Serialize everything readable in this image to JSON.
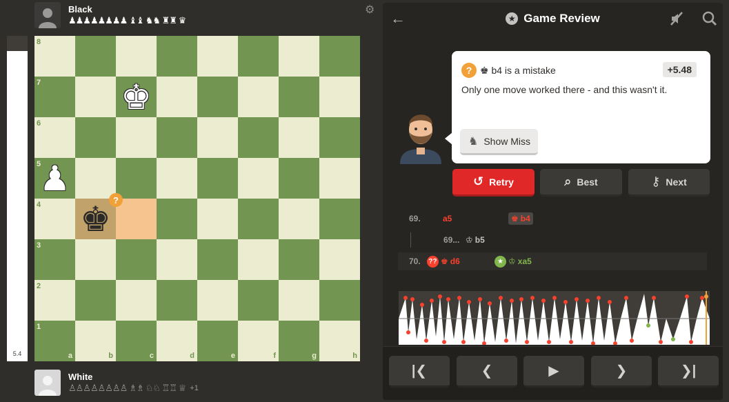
{
  "players": {
    "black": {
      "name": "Black",
      "captured": "♟♟♟♟♟♟♟♟ ♝♝ ♞♞ ♜♜ ♛"
    },
    "white": {
      "name": "White",
      "captured": "♙♙♙♙♙♙♙♙ ♗♗ ♘♘ ♖♖ ♕",
      "advantage": "+1"
    }
  },
  "eval_bar": {
    "value": "5.4",
    "white_fraction": 0.953
  },
  "board": {
    "ranks": [
      "8",
      "7",
      "6",
      "5",
      "4",
      "3",
      "2",
      "1"
    ],
    "files": [
      "a",
      "b",
      "c",
      "d",
      "e",
      "f",
      "g",
      "h"
    ],
    "pieces": [
      {
        "square": "c7",
        "glyph": "♚",
        "color": "white"
      },
      {
        "square": "a5",
        "glyph": "♟",
        "color": "white"
      },
      {
        "square": "b4",
        "glyph": "♚",
        "color": "black"
      }
    ],
    "highlight_from": "c4",
    "highlight_to": "b4",
    "annotation": "?"
  },
  "review": {
    "title": "Game Review",
    "message_move": "♚ b4 is a mistake",
    "eval": "+5.48",
    "message_text": "Only one move worked there - and this wasn't it.",
    "show_miss_label": "Show Miss",
    "retry_label": "Retry",
    "best_label": "Best",
    "next_label": "Next"
  },
  "moves": {
    "row1": {
      "num": "69.",
      "white": "a5",
      "black": "b4"
    },
    "row2": {
      "num": "69...",
      "move": "b5"
    },
    "row3": {
      "num": "70.",
      "white": "d6",
      "black": "xa5"
    }
  },
  "colors": {
    "light": "#ebecd0",
    "dark": "#739552",
    "accent_red": "#e02828",
    "mistake": "#f1a137"
  },
  "icons": [
    "settings-icon",
    "back-arrow-icon",
    "star-icon",
    "sound-off-icon",
    "analysis-icon",
    "first-move-icon",
    "prev-move-icon",
    "play-icon",
    "next-move-icon",
    "last-move-icon"
  ]
}
